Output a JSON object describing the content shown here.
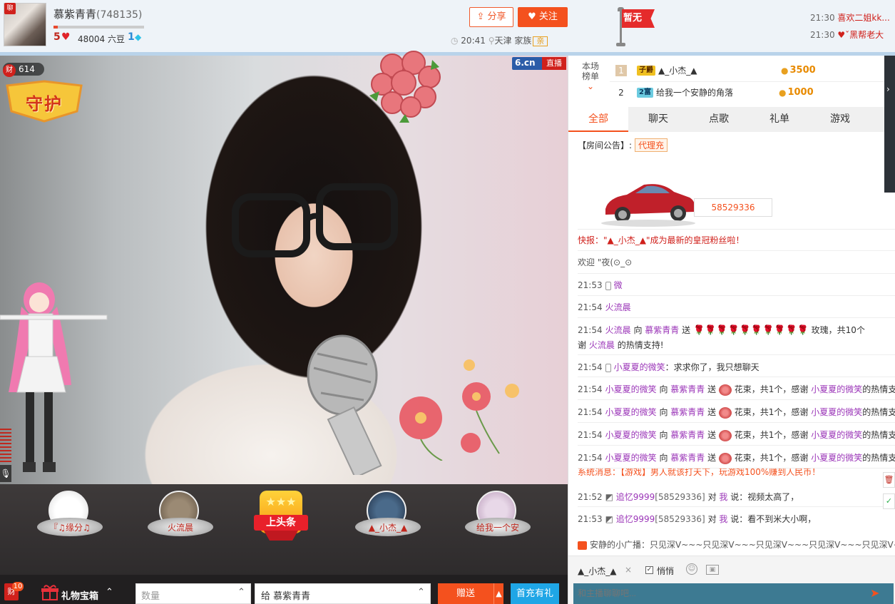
{
  "anchor": {
    "avatar_badge": "聊",
    "name": "慕紫青青",
    "id": "(748135)",
    "level": "5",
    "level_progress": 0.05,
    "beans": "48004 六豆",
    "diamond_level": "1"
  },
  "header": {
    "share_label": "分享",
    "follow_label": "关注",
    "time": "20:41",
    "location": "天津",
    "family_label": "家族",
    "family_badge": "亲",
    "flag_label": "暂无",
    "top_messages": [
      {
        "time": "21:30",
        "text": "喜欢二姐kk..."
      },
      {
        "time": "21:30",
        "text": "♥ˇ黑帮老大"
      }
    ]
  },
  "video": {
    "wealth_icon": "财",
    "wealth_count": "614",
    "guard_text": "守护",
    "logo": "6.cn",
    "live_label": "直播"
  },
  "rank_strip": {
    "items": [
      {
        "label": "『♫缘分♫"
      },
      {
        "label": "火流晨"
      },
      {
        "label": "▲_小杰_▲"
      },
      {
        "label": "给我一个安"
      }
    ],
    "headline_label": "上头条"
  },
  "bottom": {
    "wealth_icon": "财",
    "wealth_count": "10",
    "gift_box_label": "礼物宝箱",
    "quantity_placeholder": "数量",
    "to_prefix": "给",
    "to_name": "慕紫青青",
    "send_label": "赠送",
    "recharge_label": "首充有礼"
  },
  "rank_board": {
    "title_line1": "本场",
    "title_line2": "榜单",
    "rows": [
      {
        "idx": "1",
        "badge": "子爵",
        "name": "▲_小杰_▲",
        "amount": "3500"
      },
      {
        "idx": "2",
        "badge": "2富",
        "name": "给我一个安静的角落",
        "amount": "1000"
      }
    ]
  },
  "tabs": [
    "全部",
    "聊天",
    "点歌",
    "礼单",
    "游戏"
  ],
  "chat": {
    "announce_prefix": "【房间公告】:",
    "announce_tag": "代理充",
    "car_plate": "58529336",
    "news": "快报：\"▲_小杰_▲\"成为最新的皇冠粉丝啦！",
    "welcome": "欢迎 \"夜(⊙_⊙",
    "line_2153a_time": "21:53",
    "line_2153a_user": "微",
    "line_2154a_time": "21:54",
    "line_2154a_user": "火流晨",
    "line_rose_time": "21:54",
    "line_rose_user": "火流晨",
    "line_rose_to": "向",
    "line_rose_target": "慕紫青青",
    "line_rose_send": "送",
    "line_rose_gift": "玫瑰，共10个",
    "line_rose_thanks_prefix": "谢",
    "line_rose_thanks_user": "火流晨",
    "line_rose_thanks_suffix": "的热情支持!",
    "line_beg_time": "21:54",
    "line_beg_user": "小夏夏的微笑",
    "line_beg_text": "：求求你了，我只想聊天",
    "flower_lines": [
      {
        "time": "21:54",
        "user": "小夏夏的微笑",
        "to": "向",
        "target": "慕紫青青",
        "send": "送",
        "gift": "花束，共1个，感谢",
        "thanks_user": "小夏夏的微笑",
        "suffix": "的热情支"
      },
      {
        "time": "21:54",
        "user": "小夏夏的微笑",
        "to": "向",
        "target": "慕紫青青",
        "send": "送",
        "gift": "花束，共1个，感谢",
        "thanks_user": "小夏夏的微笑",
        "suffix": "的热情支"
      },
      {
        "time": "21:54",
        "user": "小夏夏的微笑",
        "to": "向",
        "target": "慕紫青青",
        "send": "送",
        "gift": "花束，共1个，感谢",
        "thanks_user": "小夏夏的微笑",
        "suffix": "的热情支"
      },
      {
        "time": "21:54",
        "user": "小夏夏的微笑",
        "to": "向",
        "target": "慕紫青青",
        "send": "送",
        "gift": "花束，共1个，感谢",
        "thanks_user": "小夏夏的微笑",
        "suffix": "的热情支"
      }
    ],
    "system_msg": "系统消息：【游戏】男人就该打天下，玩游戏100%赚到人民币！",
    "msg_2152_time": "21:52",
    "msg_2152_user": "追忆9999",
    "msg_2152_id": "[58529336]",
    "msg_2152_to": "对",
    "msg_2152_me": "我",
    "msg_2152_text": "说：视频太高了，",
    "msg_2153_time": "21:53",
    "msg_2153_user": "追忆9999",
    "msg_2153_id": "[58529336]",
    "msg_2153_to": "对",
    "msg_2153_me": "我",
    "msg_2153_text": "说：看不到米大小啊，",
    "broadcast": "安静的小广播：只见深V~~~只见深V~~~只见深V~~~只见深V~~~只见深V~~~"
  },
  "input": {
    "target_user": "▲_小杰_▲",
    "close": "×",
    "whisper_label": "悄悄",
    "placeholder": "和主播聊聊吧..."
  },
  "colors": {
    "accent": "#f4511e",
    "user": "#9b36b8",
    "alert": "#d0211c",
    "recharge": "#1fa6e6"
  }
}
